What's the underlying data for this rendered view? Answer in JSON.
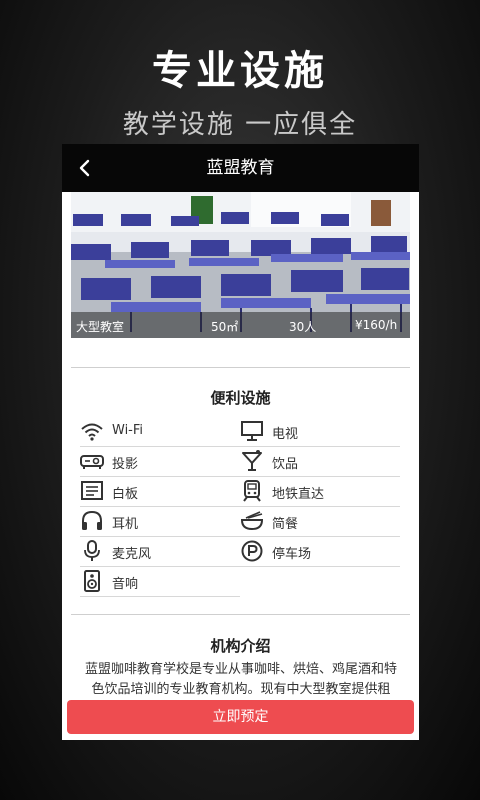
{
  "promo": {
    "title": "专业设施",
    "subtitle": "教学设施 一应俱全"
  },
  "nav": {
    "title": "蓝盟教育"
  },
  "room": {
    "name": "大型教室",
    "area": "50㎡",
    "capacity": "30人",
    "price": "¥160/h"
  },
  "amenities": {
    "title": "便利设施",
    "items": [
      {
        "label": "Wi-Fi",
        "icon": "wifi-icon"
      },
      {
        "label": "电视",
        "icon": "tv-icon"
      },
      {
        "label": "投影",
        "icon": "projector-icon"
      },
      {
        "label": "饮品",
        "icon": "cocktail-icon"
      },
      {
        "label": "白板",
        "icon": "whiteboard-icon"
      },
      {
        "label": "地铁直达",
        "icon": "subway-icon"
      },
      {
        "label": "耳机",
        "icon": "headphones-icon"
      },
      {
        "label": "简餐",
        "icon": "bowl-icon"
      },
      {
        "label": "麦克风",
        "icon": "microphone-icon"
      },
      {
        "label": "停车场",
        "icon": "parking-icon"
      },
      {
        "label": "音响",
        "icon": "speaker-icon"
      }
    ]
  },
  "intro": {
    "title": "机构介绍",
    "text": "蓝盟咖啡教育学校是专业从事咖啡、烘焙、鸡尾酒和特色饮品培训的专业教育机构。现有中大型教室提供租"
  },
  "booking": {
    "button_label": "立即预定"
  },
  "colors": {
    "accent": "#ee4c50",
    "nav_bg": "#070707"
  }
}
